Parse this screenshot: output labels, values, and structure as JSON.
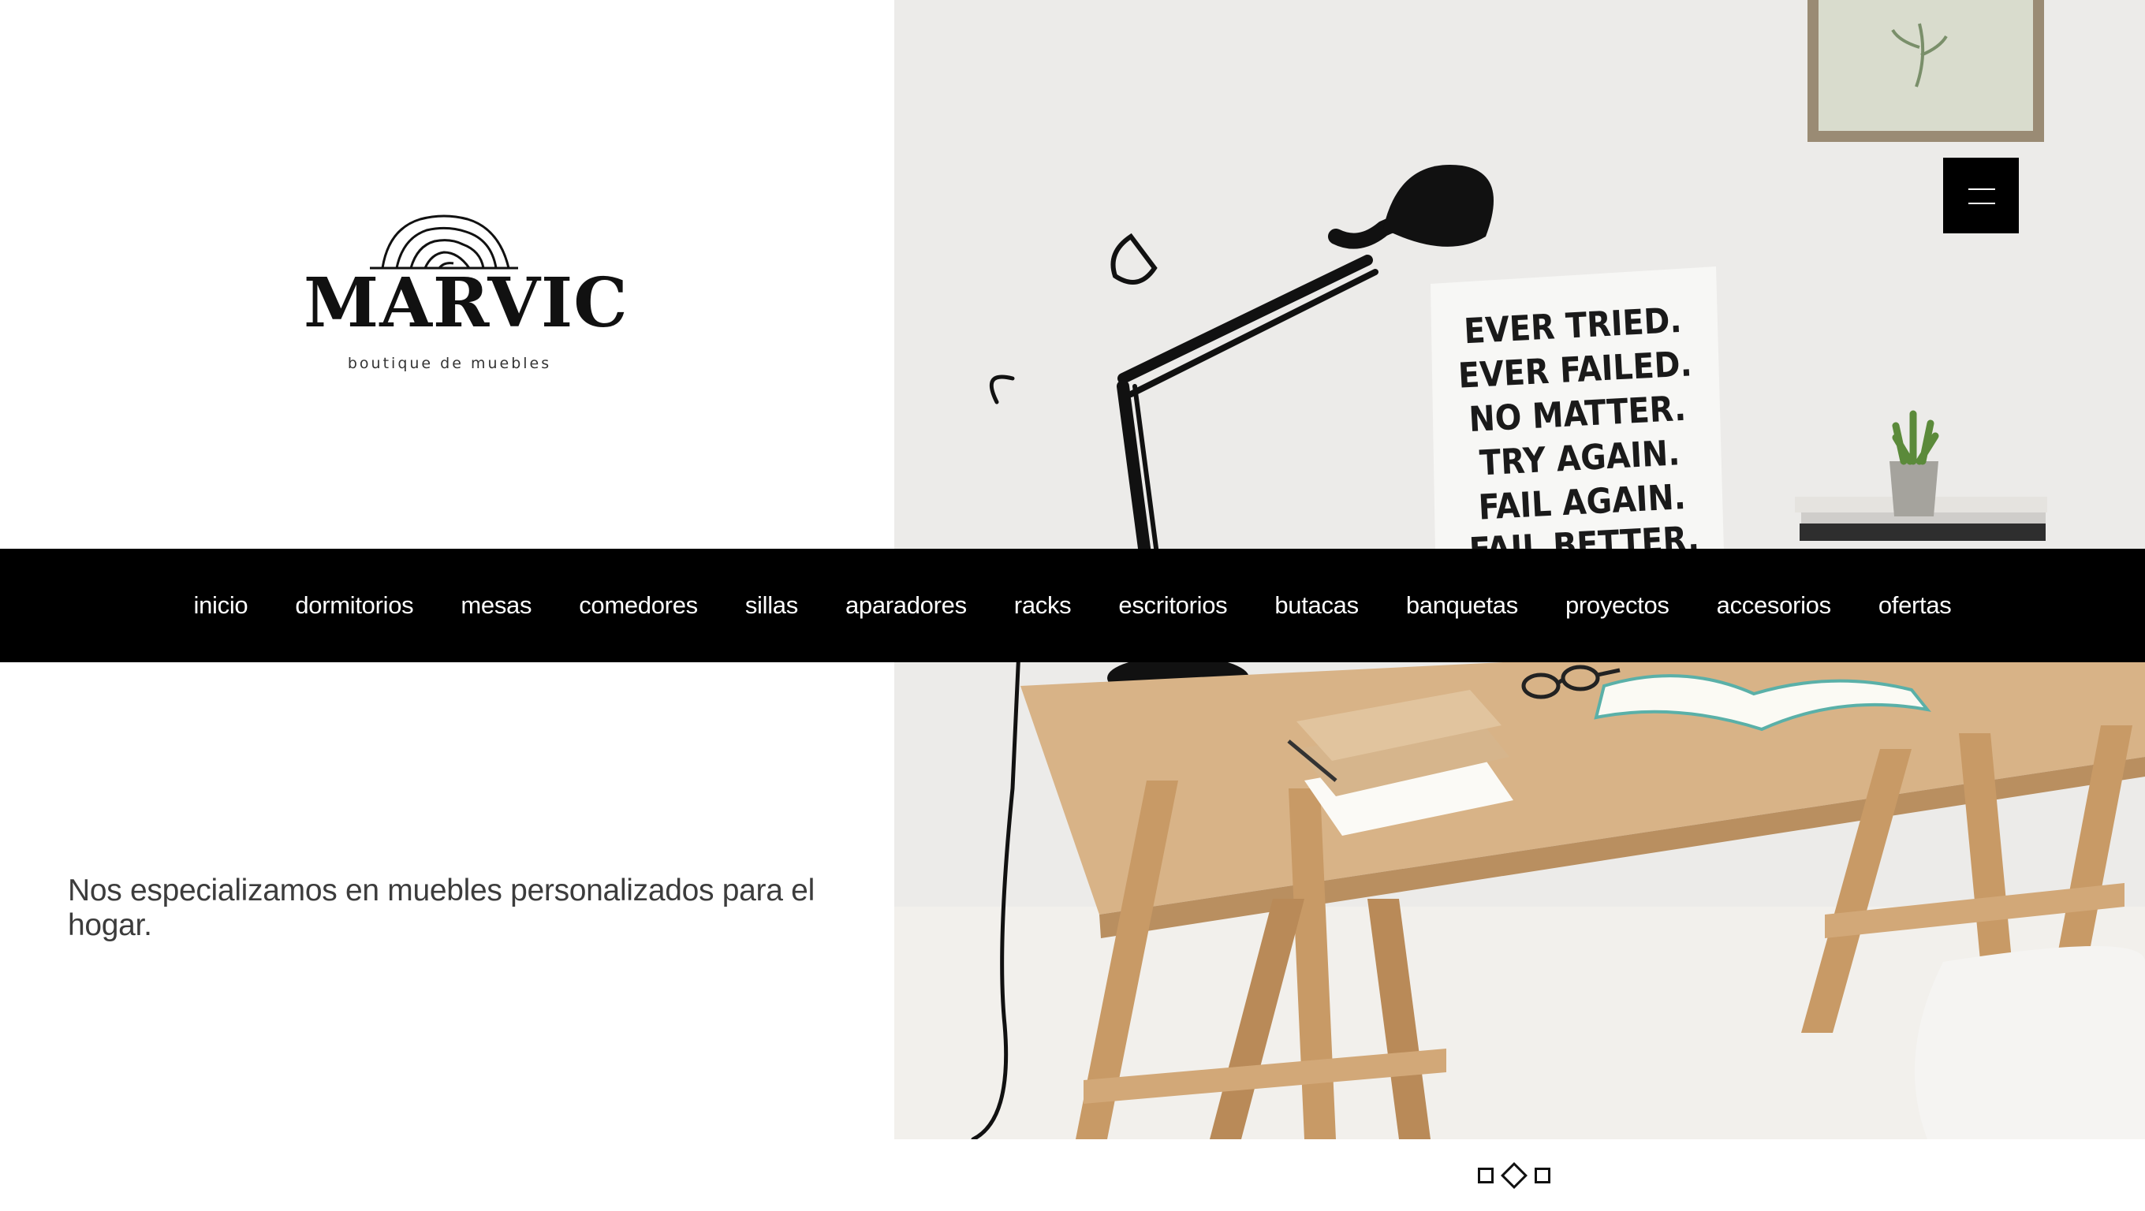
{
  "brand": {
    "name": "MARVIC",
    "tagline_small": "boutique de muebles",
    "logo_icon": "tree-rings-icon"
  },
  "menu_button": {
    "icon": "hamburger-icon"
  },
  "nav": {
    "items": [
      {
        "label": "inicio"
      },
      {
        "label": "dormitorios"
      },
      {
        "label": "mesas"
      },
      {
        "label": "comedores"
      },
      {
        "label": "sillas"
      },
      {
        "label": "aparadores"
      },
      {
        "label": "racks"
      },
      {
        "label": "escritorios"
      },
      {
        "label": "butacas"
      },
      {
        "label": "banquetas"
      },
      {
        "label": "proyectos"
      },
      {
        "label": "accesorios"
      },
      {
        "label": "ofertas"
      }
    ]
  },
  "hero": {
    "tagline": "Nos especializamos en muebles personalizados para el hogar.",
    "poster_lines": [
      "EVER TRIED.",
      "EVER FAILED.",
      "NO MATTER.",
      "TRY AGAIN.",
      "FAIL AGAIN.",
      "FAIL BETTER."
    ]
  },
  "slider": {
    "slide_count": 3,
    "active_index": 1
  },
  "colors": {
    "nav_bg": "#000000",
    "nav_text": "#ffffff",
    "wood": "#d8b387"
  }
}
